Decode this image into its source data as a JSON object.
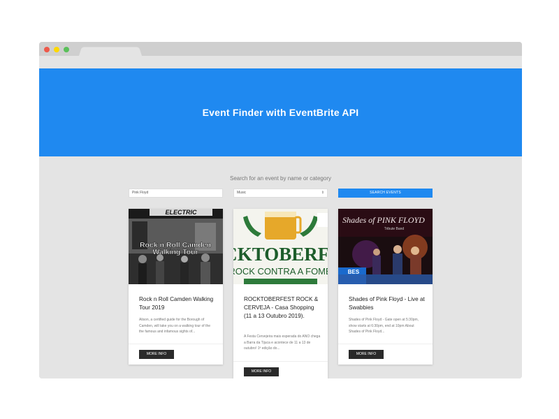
{
  "hero": {
    "title": "Event Finder with EventBrite API"
  },
  "search": {
    "heading": "Search for an event by name or category",
    "name_value": "Pink Floyd",
    "category_value": "Music",
    "button_label": "SEARCH EVENTS"
  },
  "events": [
    {
      "image_text_1": "ELECTRIC",
      "image_text_2": "Rock n Roll Camden",
      "image_text_3": "Walking Tour",
      "title": "Rock n Roll Camden Walking Tour 2019",
      "description": "Alison, a certified guide for the Borough of Camden, will take you on a walking tour of the the famous and infamous sights of...",
      "button_label": "MORE INFO"
    },
    {
      "image_text_1": "ROCKTOBERFEST",
      "image_text_2": "ROCK CONTRA A FOME",
      "title": "ROCKTOBERFEST ROCK & CERVEJA - Casa Shopping (11 a 13 Outubro 2019).",
      "description": "A Festa Cervejeira mais esperada do ANO chega a Barra da Tijuca e acontece de 11 a 13 de outubro! 1ª edição do...",
      "button_label": "MORE INFO"
    },
    {
      "image_text_1": "Shades of PINK FLOYD",
      "image_text_2": "Tribute Band",
      "title": "Shades of Pink Floyd - Live at Swabbies",
      "description": "Shades of Pink Floyd - Gate open at 5:30pm, show starts at 6:30pm, end at 10pm About Shades of Pink Floyd...",
      "button_label": "MORE INFO"
    }
  ],
  "colors": {
    "accent": "#1f89f0",
    "background": "#e4e4e4",
    "button_dark": "#2a2a2a"
  }
}
